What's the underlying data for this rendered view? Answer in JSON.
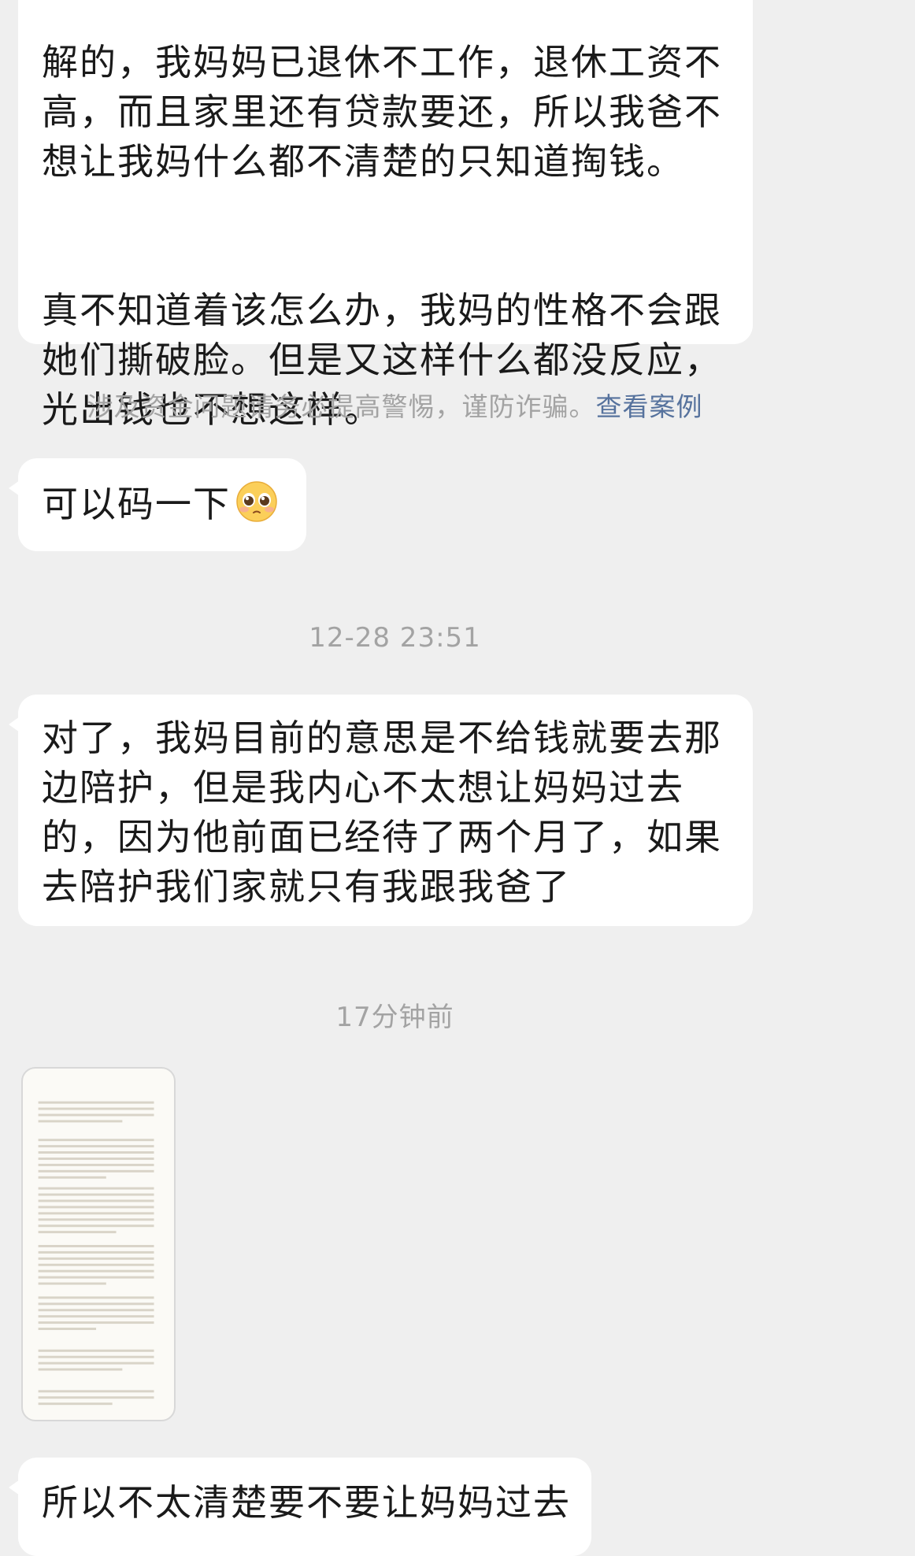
{
  "messages": {
    "msg1": {
      "paragraph1": "解的，我妈妈已退休不工作，退休工资不\n高，而且家里还有贷款要还，所以我爸不\n想让我妈什么都不清楚的只知道掏钱。",
      "paragraph2": "真不知道着该怎么办，我妈的性格不会跟\n她们撕破脸。但是又这样什么都没反应，\n光出钱也不想这样。"
    },
    "notice": {
      "text": "涉及资金问题请务必提高警惕，谨防诈骗。",
      "link": "查看案例"
    },
    "msg2": {
      "text": "可以码一下",
      "emoji": "pleading-face-emoji"
    },
    "time1": "12-28 23:51",
    "msg3": {
      "text": "对了，我妈目前的意思是不给钱就要去那\n边陪护，但是我内心不太想让妈妈过去\n的，因为他前面已经待了两个月了，如果\n去陪护我们家就只有我跟我爸了"
    },
    "time2": "17分钟前",
    "msg4": {
      "text": "所以不太清楚要不要让妈妈过去"
    }
  },
  "colors": {
    "background": "#efefef",
    "bubble": "#ffffff",
    "text": "#1a1a1a",
    "meta_text": "#a3a3a3",
    "link": "#56729d"
  }
}
